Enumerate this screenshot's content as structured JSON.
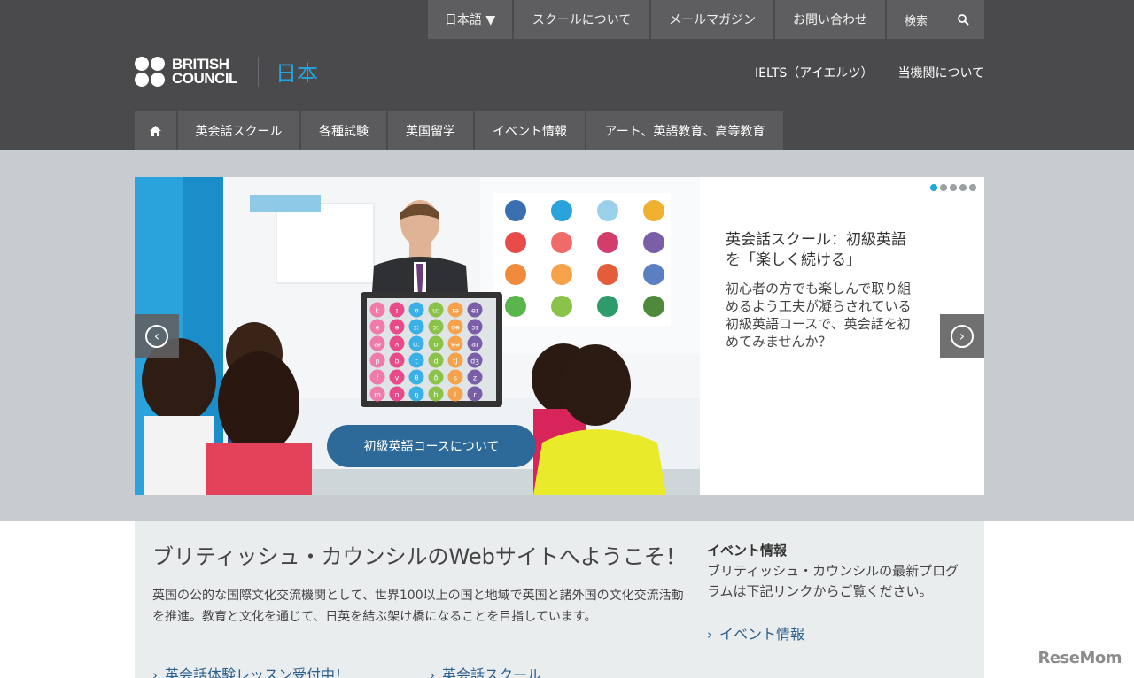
{
  "topnav": {
    "language": "日本語 ▼",
    "school": "スクールについて",
    "mail": "メールマガジン",
    "contact": "お問い合わせ",
    "search": "検索"
  },
  "logo": {
    "line1": "BRITISH",
    "line2": "COUNCIL",
    "country": "日本"
  },
  "rightlinks": {
    "ielts": "IELTS（アイエルツ）",
    "about": "当機関について"
  },
  "mainnav": {
    "items": [
      "英会話スクール",
      "各種試験",
      "英国留学",
      "イベント情報",
      "アート、英語教育、高等教育"
    ]
  },
  "slider": {
    "title": "英会話スクール：初級英語を「楽しく続ける」",
    "description": "初心者の方でも楽しんで取り組めるよう工夫が凝らされている初級英語コースで、英会話を初めてみませんか？",
    "cta": "初級英語コースについて",
    "active_dot": 1,
    "total_dots": 5,
    "board_symbols": [
      "iː",
      "ɪ",
      "ʊ",
      "uː",
      "ɪə",
      "eɪ",
      "e",
      "ə",
      "ɜː",
      "ɔː",
      "ʊə",
      "ɔɪ",
      "æ",
      "ʌ",
      "ɑː",
      "ɒ",
      "eə",
      "aɪ",
      "p",
      "b",
      "t",
      "d",
      "tʃ",
      "dʒ",
      "f",
      "v",
      "θ",
      "ð",
      "s",
      "z",
      "m",
      "n",
      "ŋ",
      "h",
      "l",
      "r"
    ]
  },
  "content": {
    "welcome": "ブリティッシュ・カウンシルのWebサイトへようこそ！",
    "intro": "英国の公的な国際文化交流機関として、世界100以上の国と地域で英国と諸外国の文化交流活動を推進。教育と文化を通じて、日英を結ぶ架け橋になることを目指しています。",
    "link1": "英会話体験レッスン受付中！",
    "link2": "英会話スクール",
    "event_heading": "イベント情報",
    "event_desc": "ブリティッシュ・カウンシルの最新プログラムは下記リンクからご覧ください。",
    "event_link": "イベント情報"
  },
  "watermark": "ReseMom",
  "colors": {
    "header_bg": "#4a4a4c",
    "nav_item_bg": "#5b5b5e",
    "accent_blue": "#21a7e0",
    "cta_blue": "#2d6a9a",
    "link_blue": "#2c5f8d",
    "band_bg": "#c6ccd0"
  }
}
